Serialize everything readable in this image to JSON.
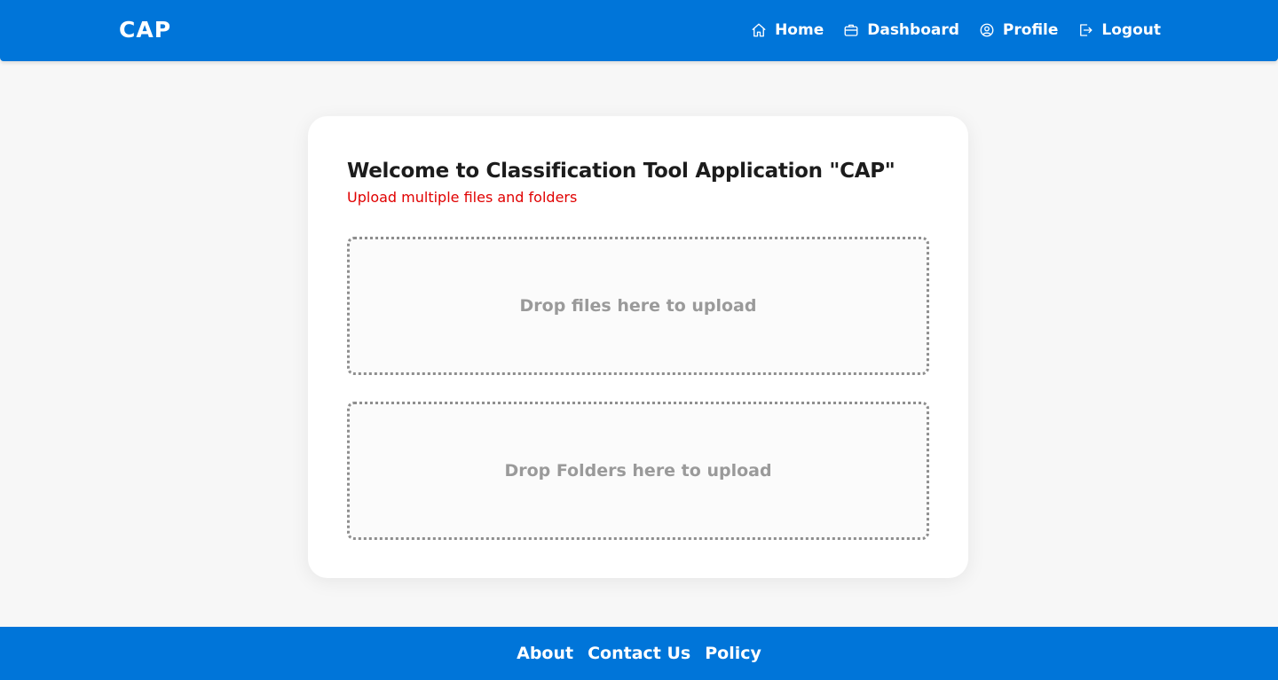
{
  "colors": {
    "primary": "#0075d9",
    "background": "#f7f7f7",
    "card": "#ffffff",
    "subtitle": "#e00000",
    "dropzone_text": "#9a9a9a"
  },
  "header": {
    "brand": "CAP",
    "nav": [
      {
        "label": "Home",
        "icon": "home-icon"
      },
      {
        "label": "Dashboard",
        "icon": "briefcase-icon"
      },
      {
        "label": "Profile",
        "icon": "user-circle-icon"
      },
      {
        "label": "Logout",
        "icon": "logout-icon"
      }
    ]
  },
  "main": {
    "title": "Welcome to Classification Tool Application \"CAP\"",
    "subtitle": "Upload multiple files and folders",
    "dropzones": [
      {
        "label": "Drop files here to upload"
      },
      {
        "label": "Drop Folders here to upload"
      }
    ]
  },
  "footer": {
    "links": [
      "About",
      "Contact Us",
      "Policy"
    ]
  }
}
